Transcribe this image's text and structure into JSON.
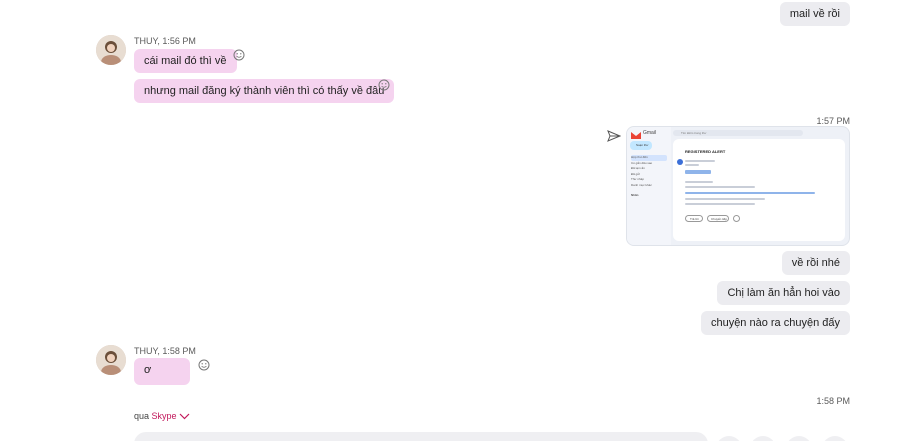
{
  "messages": {
    "out_top": "mail về rồi",
    "thuy_1": {
      "sender": "THUY, 1:56 PM",
      "m1": "cái mail đó thì về",
      "m2": "nhưng mail đăng ký thành viên thì có thấy về đâu"
    },
    "time_157": "1:57 PM",
    "out_157": [
      "về rồi nhé",
      "Chị làm ăn hẳn hoi vào",
      "chuyện nào ra chuyện đấy"
    ],
    "thuy_2": {
      "sender": "THUY, 1:58 PM",
      "m1": "ơ"
    },
    "time_158": "1:58 PM"
  },
  "screenshot": {
    "app_label": "Gmail",
    "search_placeholder": "Tìm kiếm trong thư",
    "compose_label": "Soạn thư",
    "subject": "REGISTERED ALERT",
    "labels": [
      "Hộp thư đến",
      "Có gắn dấu sao",
      "Đã tạm ẩn",
      "Đã gửi",
      "Thư nháp",
      "Danh mục khác"
    ],
    "section_label": "Nhãn",
    "reply_label": "Trả lời",
    "forward_label": "Chuyển tiếp"
  },
  "footer": {
    "via_prefix": "qua ",
    "via_service": "Skype"
  },
  "colors": {
    "incoming_bubble": "#f5d3ef",
    "outgoing_bubble": "#ececf0",
    "accent": "#c2185b"
  }
}
